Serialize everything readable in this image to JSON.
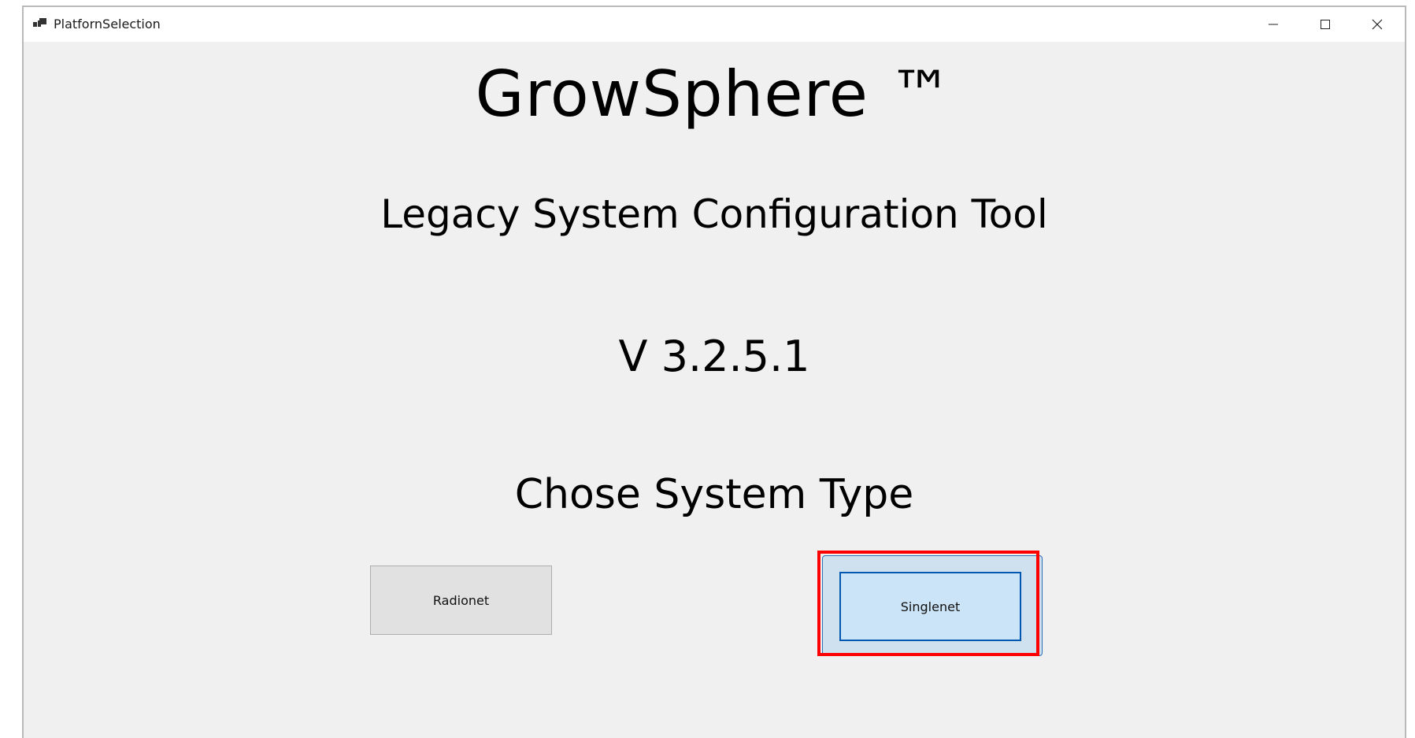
{
  "window": {
    "title": "PlatfornSelection",
    "controls": {
      "minimize_icon": "minimize-icon",
      "maximize_icon": "maximize-icon",
      "close_icon": "close-icon"
    }
  },
  "main": {
    "app_name": "GrowSphere ™",
    "subtitle": "Legacy System Configuration Tool",
    "version": "V 3.2.5.1",
    "prompt": "Chose System Type"
  },
  "buttons": {
    "radionet": "Radionet",
    "singlenet": "Singlenet"
  },
  "colors": {
    "window_bg": "#f0f0f0",
    "focus_highlight": "#ff0000",
    "selected_button_border": "#0058b0",
    "selected_button_bg": "#cce4f7"
  }
}
